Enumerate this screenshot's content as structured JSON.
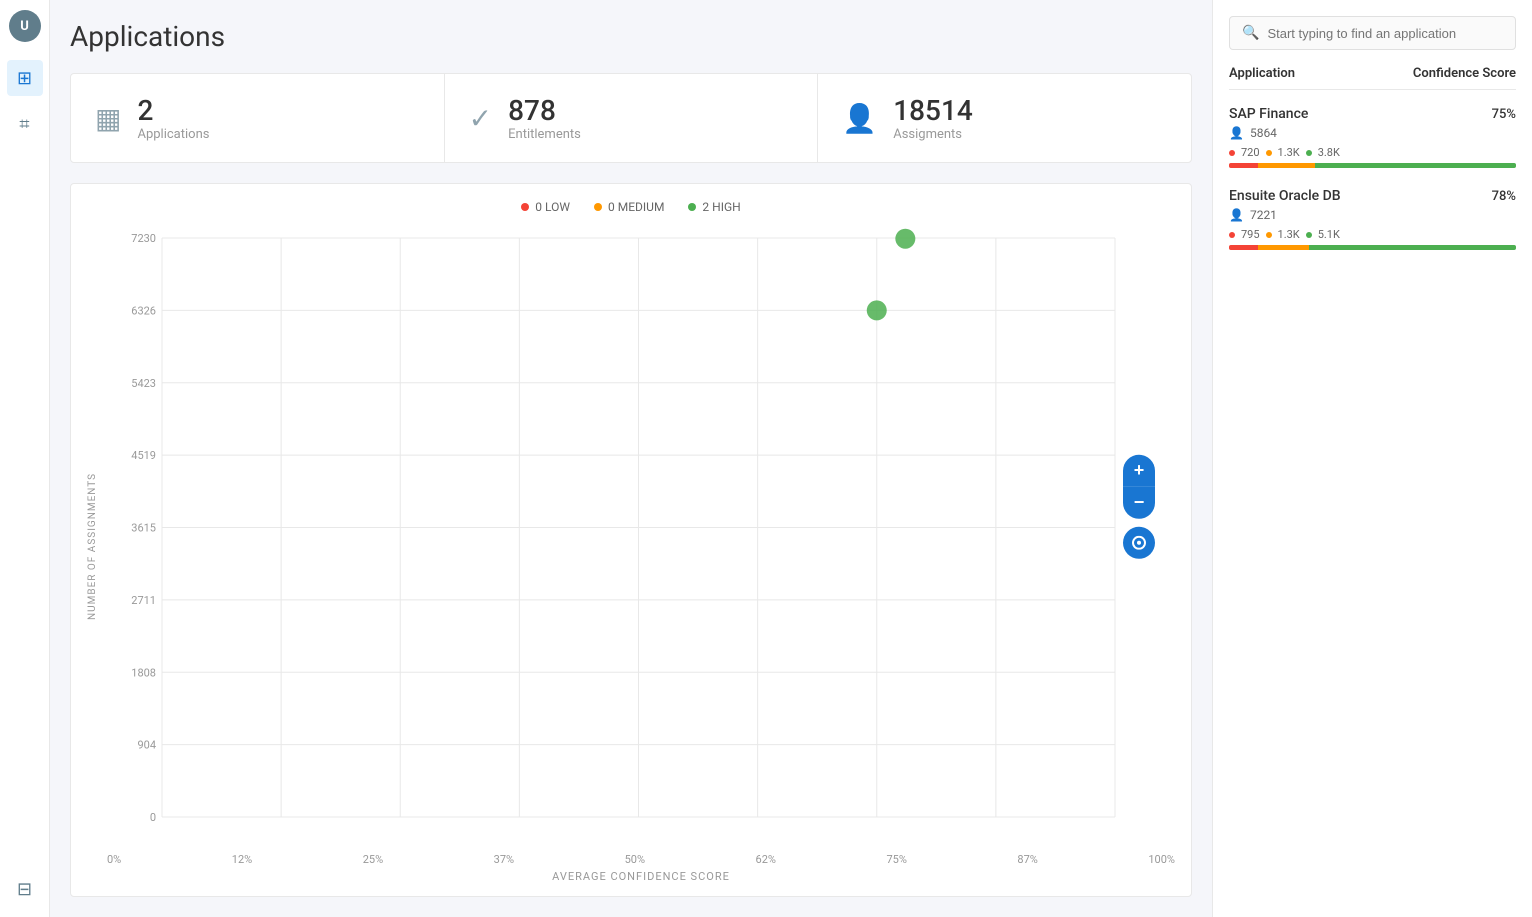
{
  "page": {
    "title": "Applications"
  },
  "sidebar": {
    "avatar_initials": "U",
    "items": [
      {
        "id": "grid",
        "icon": "⊞",
        "active": true
      },
      {
        "id": "tag",
        "icon": "⌗",
        "active": false
      }
    ],
    "bottom_item": {
      "id": "grid-bottom",
      "icon": "⊟"
    }
  },
  "stats": [
    {
      "id": "applications",
      "icon": "▦",
      "number": "2",
      "label": "Applications"
    },
    {
      "id": "entitlements",
      "icon": "✓",
      "number": "878",
      "label": "Entitlements"
    },
    {
      "id": "assignments",
      "icon": "👤",
      "number": "18514",
      "label": "Assigments"
    }
  ],
  "legend": [
    {
      "id": "low",
      "label": "0 LOW",
      "color": "#f44336"
    },
    {
      "id": "medium",
      "label": "0 MEDIUM",
      "color": "#ff9800"
    },
    {
      "id": "high",
      "label": "2 HIGH",
      "color": "#4caf50"
    }
  ],
  "chart": {
    "y_axis_label": "NUMBER OF ASSIGNMENTS",
    "x_axis_label": "AVERAGE CONFIDENCE SCORE",
    "y_ticks": [
      "7230",
      "6326",
      "5423",
      "4519",
      "3615",
      "2711",
      "1808",
      "904",
      "0"
    ],
    "x_ticks": [
      "0%",
      "12%",
      "25%",
      "37%",
      "50%",
      "62%",
      "75%",
      "87%",
      "100%"
    ],
    "zoom_plus": "+",
    "zoom_minus": "−",
    "zoom_reset": "○",
    "data_points": [
      {
        "x_pct": 75,
        "y_val": 6326,
        "color": "#4caf50",
        "size": 14
      },
      {
        "x_pct": 78,
        "y_val": 7221,
        "color": "#4caf50",
        "size": 14
      }
    ]
  },
  "right_panel": {
    "search_placeholder": "Start typing to find an application",
    "col_application": "Application",
    "col_confidence": "Confidence Score",
    "applications": [
      {
        "id": "sap-finance",
        "name": "SAP Finance",
        "score": "75%",
        "users": "5864",
        "score_low": "720",
        "score_medium": "1.3K",
        "score_high": "3.8K",
        "bar_red_pct": 10,
        "bar_orange_pct": 20,
        "bar_green_pct": 70
      },
      {
        "id": "ensuite-oracle",
        "name": "Ensuite Oracle DB",
        "score": "78%",
        "users": "7221",
        "score_low": "795",
        "score_medium": "1.3K",
        "score_high": "5.1K",
        "bar_red_pct": 10,
        "bar_orange_pct": 18,
        "bar_green_pct": 72
      }
    ]
  }
}
